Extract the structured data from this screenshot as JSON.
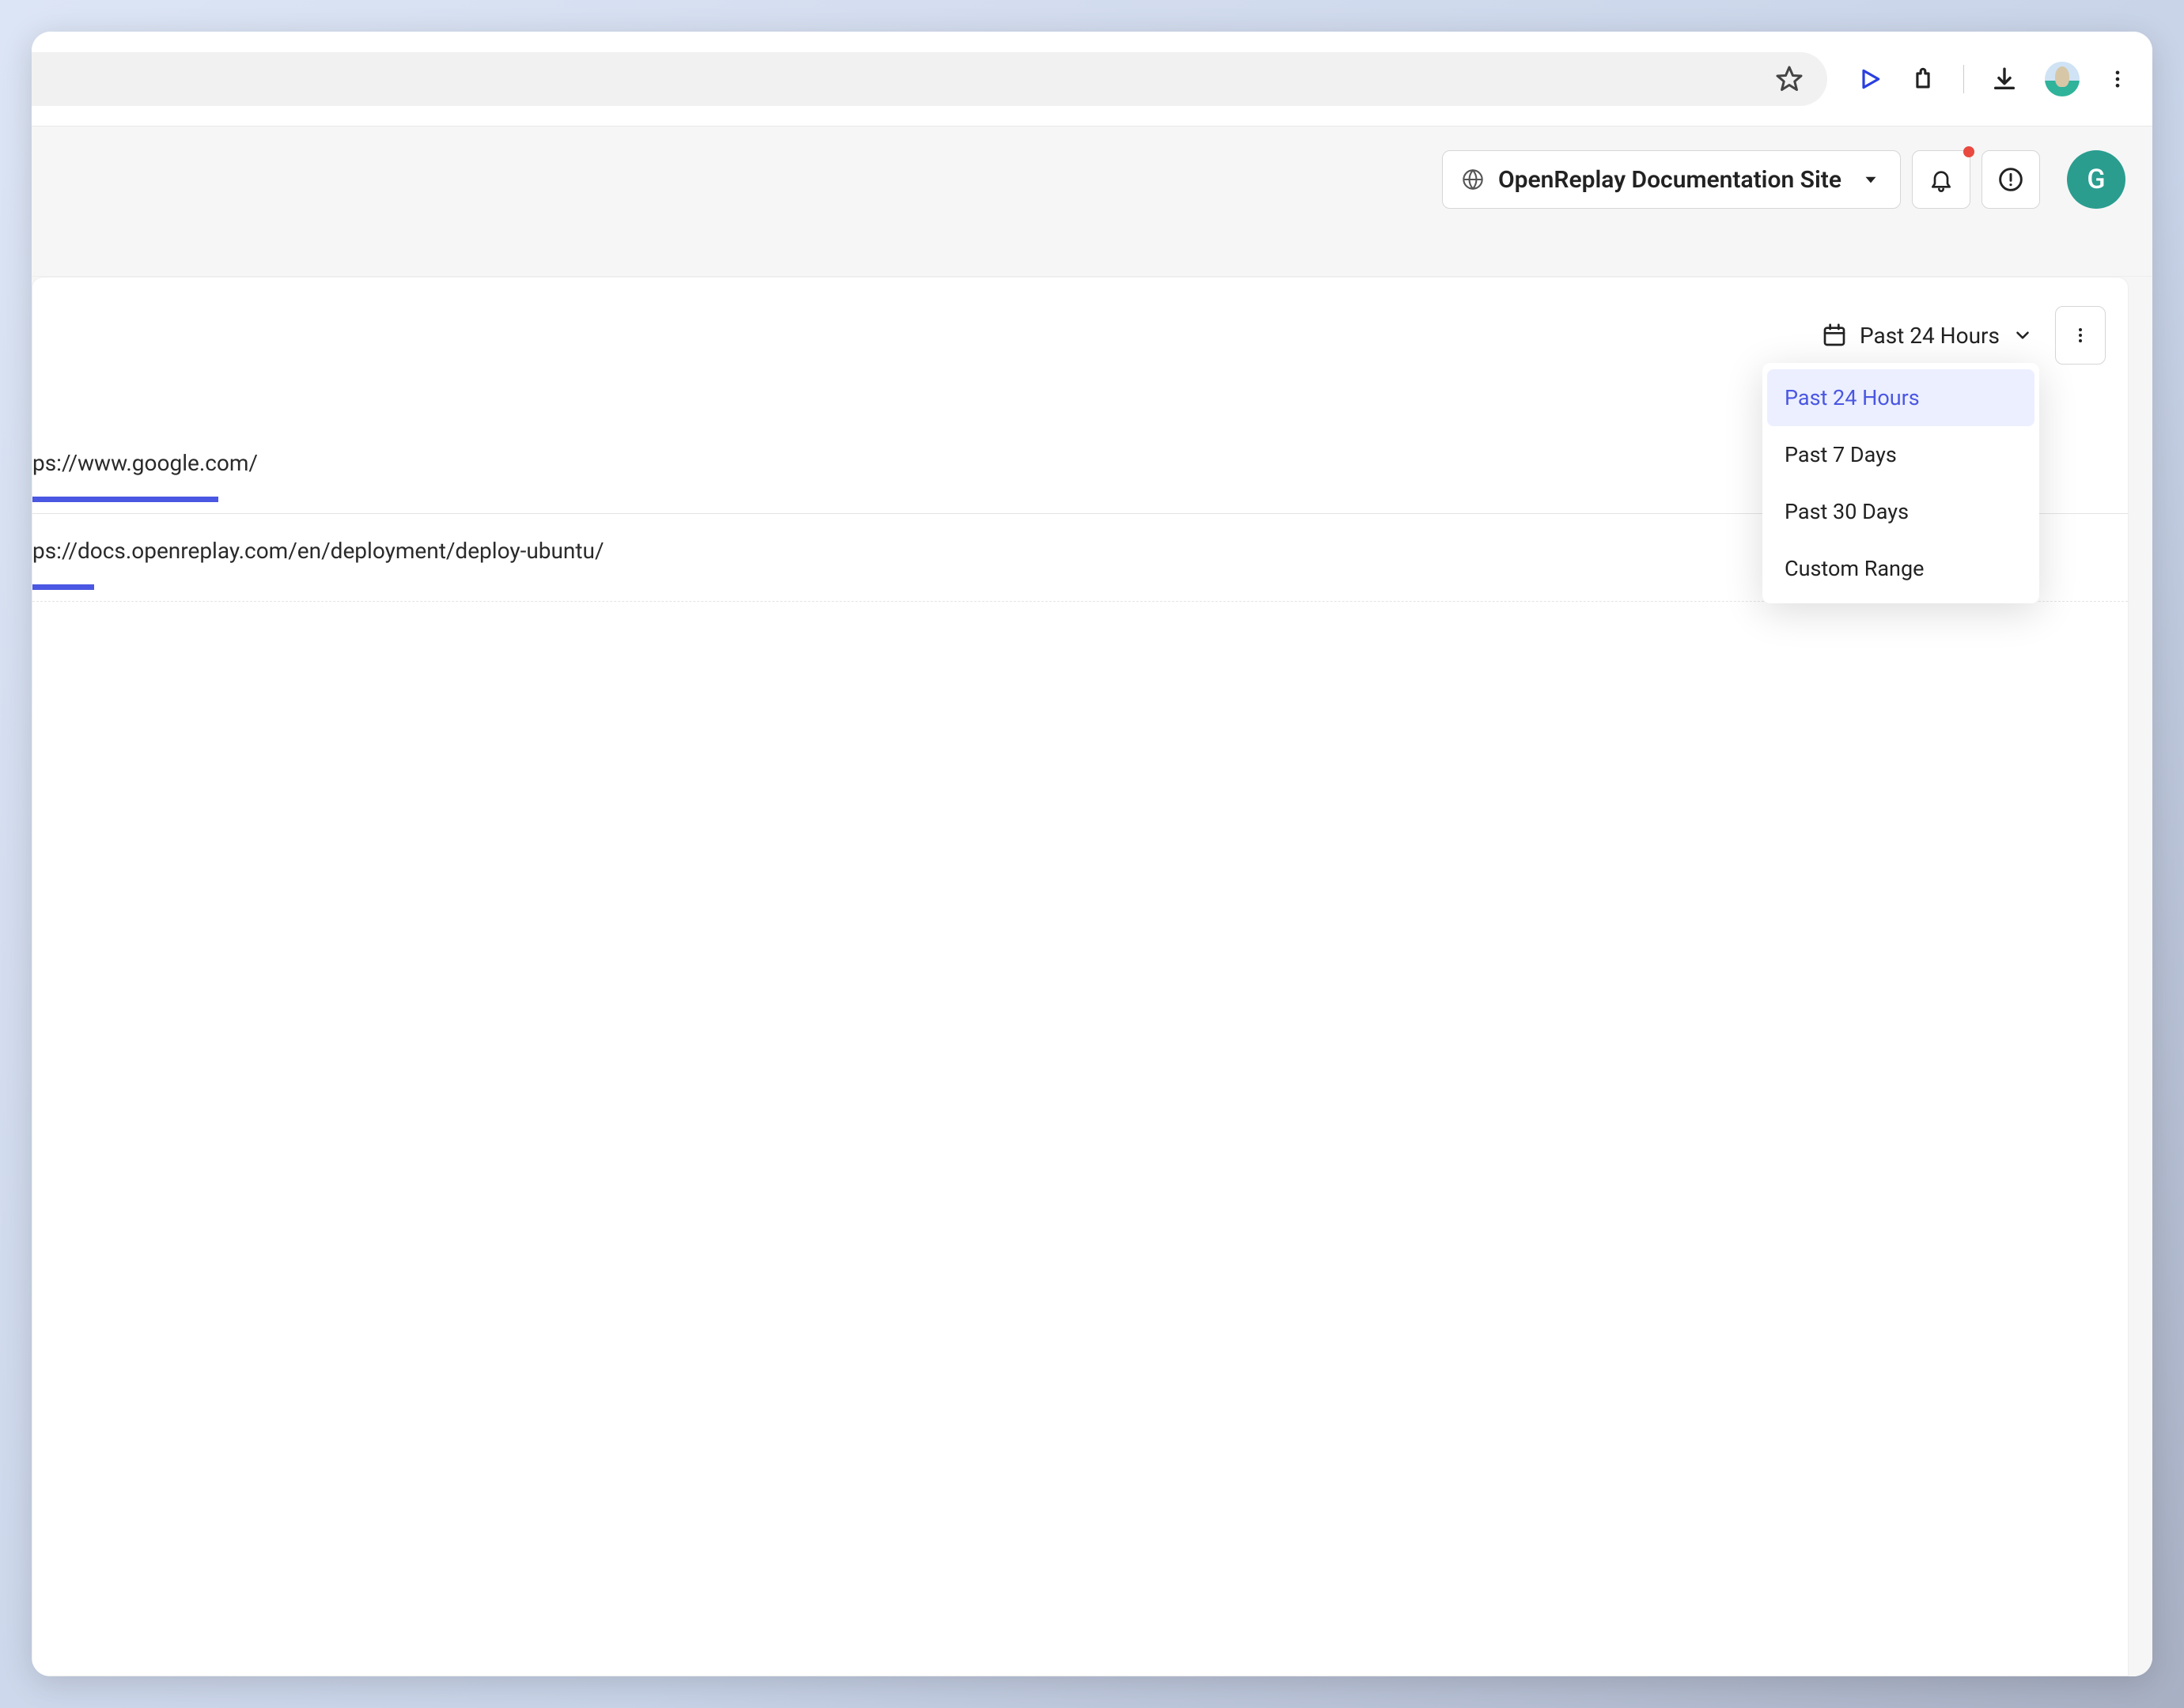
{
  "browser": {
    "omnibox_value": ""
  },
  "header": {
    "project_name": "OpenReplay Documentation Site",
    "avatar_initial": "G",
    "has_notification": true
  },
  "date_filter": {
    "current": "Past 24 Hours",
    "options": [
      "Past 24 Hours",
      "Past 7 Days",
      "Past 30 Days",
      "Custom Range"
    ],
    "selected_index": 0
  },
  "items": [
    {
      "url": "ps://www.google.com/",
      "bar_pct": 9
    },
    {
      "url": "ps://docs.openreplay.com/en/deployment/deploy-ubuntu/",
      "bar_pct": 3
    }
  ]
}
